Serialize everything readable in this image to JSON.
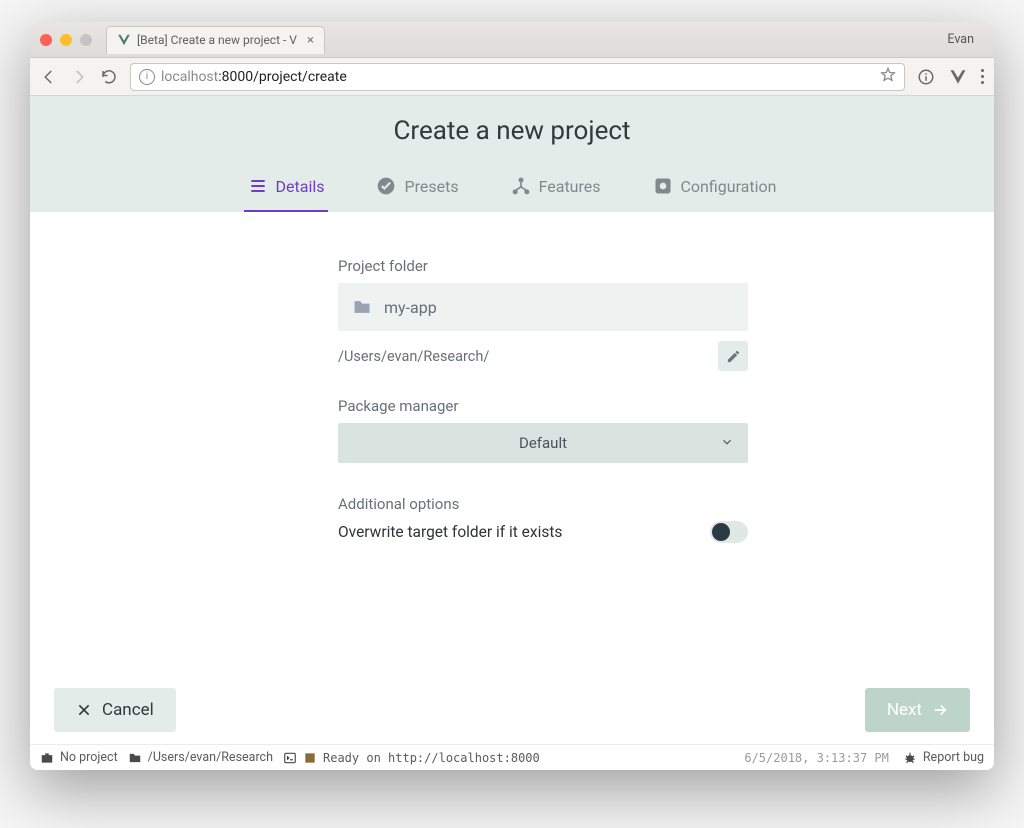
{
  "browser": {
    "profile": "Evan",
    "tab_title": "[Beta] Create a new project - V",
    "url_host_dim": "localhost",
    "url_port": ":8000",
    "url_path": "/project/create"
  },
  "header": {
    "title": "Create a new project"
  },
  "tabs": [
    {
      "label": "Details",
      "active": true
    },
    {
      "label": "Presets",
      "active": false
    },
    {
      "label": "Features",
      "active": false
    },
    {
      "label": "Configuration",
      "active": false
    }
  ],
  "form": {
    "project_folder_label": "Project folder",
    "project_folder_value": "my-app",
    "path_text": "/Users/evan/Research/",
    "package_manager_label": "Package manager",
    "package_manager_selected": "Default",
    "additional_options_label": "Additional options",
    "overwrite_label": "Overwrite target folder if it exists",
    "overwrite_value": false
  },
  "actions": {
    "cancel": "Cancel",
    "next": "Next"
  },
  "status": {
    "no_project": "No project",
    "cwd": "/Users/evan/Research",
    "ready_text": "Ready on http://localhost:8000",
    "timestamp": "6/5/2018, 3:13:37 PM",
    "report_bug": "Report bug"
  },
  "colors": {
    "accent": "#6f3cc9",
    "panel": "#e4ece9"
  }
}
